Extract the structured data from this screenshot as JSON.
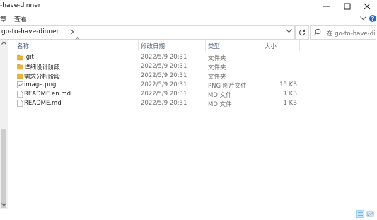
{
  "window": {
    "title": "-have-dinner"
  },
  "ribbon": {
    "tabs": [
      "章",
      "查看"
    ]
  },
  "address": {
    "path": "go-to-have-dinner",
    "search_placeholder": "在 go-to-have-di..."
  },
  "columns": {
    "name": "名称",
    "date": "修改日期",
    "type": "类型",
    "size": "大小"
  },
  "files": [
    {
      "icon": "folder-icon",
      "name": ".git",
      "date": "2022/5/9 20:31",
      "type": "文件夹",
      "size": ""
    },
    {
      "icon": "folder-icon",
      "name": "详细设计阶段",
      "date": "2022/5/9 20:31",
      "type": "文件夹",
      "size": ""
    },
    {
      "icon": "folder-icon",
      "name": "需求分析阶段",
      "date": "2022/5/9 20:31",
      "type": "文件夹",
      "size": ""
    },
    {
      "icon": "image-file-icon",
      "name": "image.png",
      "date": "2022/5/9 20:31",
      "type": "PNG 图片文件",
      "size": "15 KB"
    },
    {
      "icon": "document-icon",
      "name": "README.en.md",
      "date": "2022/5/9 20:31",
      "type": "MD 文件",
      "size": "1 KB"
    },
    {
      "icon": "document-icon",
      "name": "README.md",
      "date": "2022/5/9 20:31",
      "type": "MD 文件",
      "size": "1 KB"
    }
  ],
  "colors": {
    "folder": "#e8b53a",
    "help": "#1e6bd6",
    "header_text": "#4c607a"
  }
}
